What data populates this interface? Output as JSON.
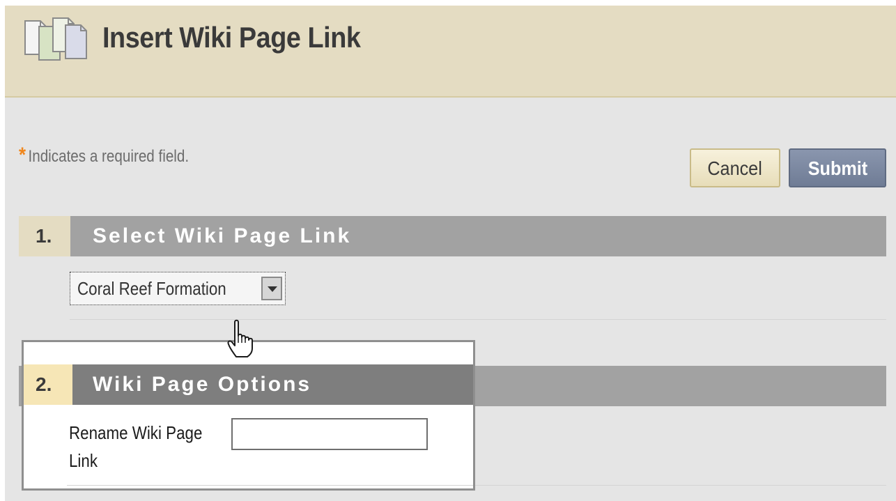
{
  "header": {
    "title": "Insert Wiki Page Link",
    "icon": "wiki-pages-icon"
  },
  "required_note": {
    "star": "*",
    "text": "Indicates a required field.",
    "star_color": "#f0861c"
  },
  "buttons": {
    "cancel": "Cancel",
    "submit": "Submit"
  },
  "section1": {
    "number": "1.",
    "title": "Select Wiki Page Link",
    "select_value": "Coral Reef Formation"
  },
  "section2": {
    "number": "2.",
    "title": "Wiki Page Options",
    "rename_label": "Rename Wiki Page Link",
    "rename_value": ""
  },
  "colors": {
    "header_bg": "#e4dcc2",
    "section_bar": "#a2a2a2",
    "submit_bg": "#7b88a2",
    "cancel_bg": "#f0e8cc"
  }
}
